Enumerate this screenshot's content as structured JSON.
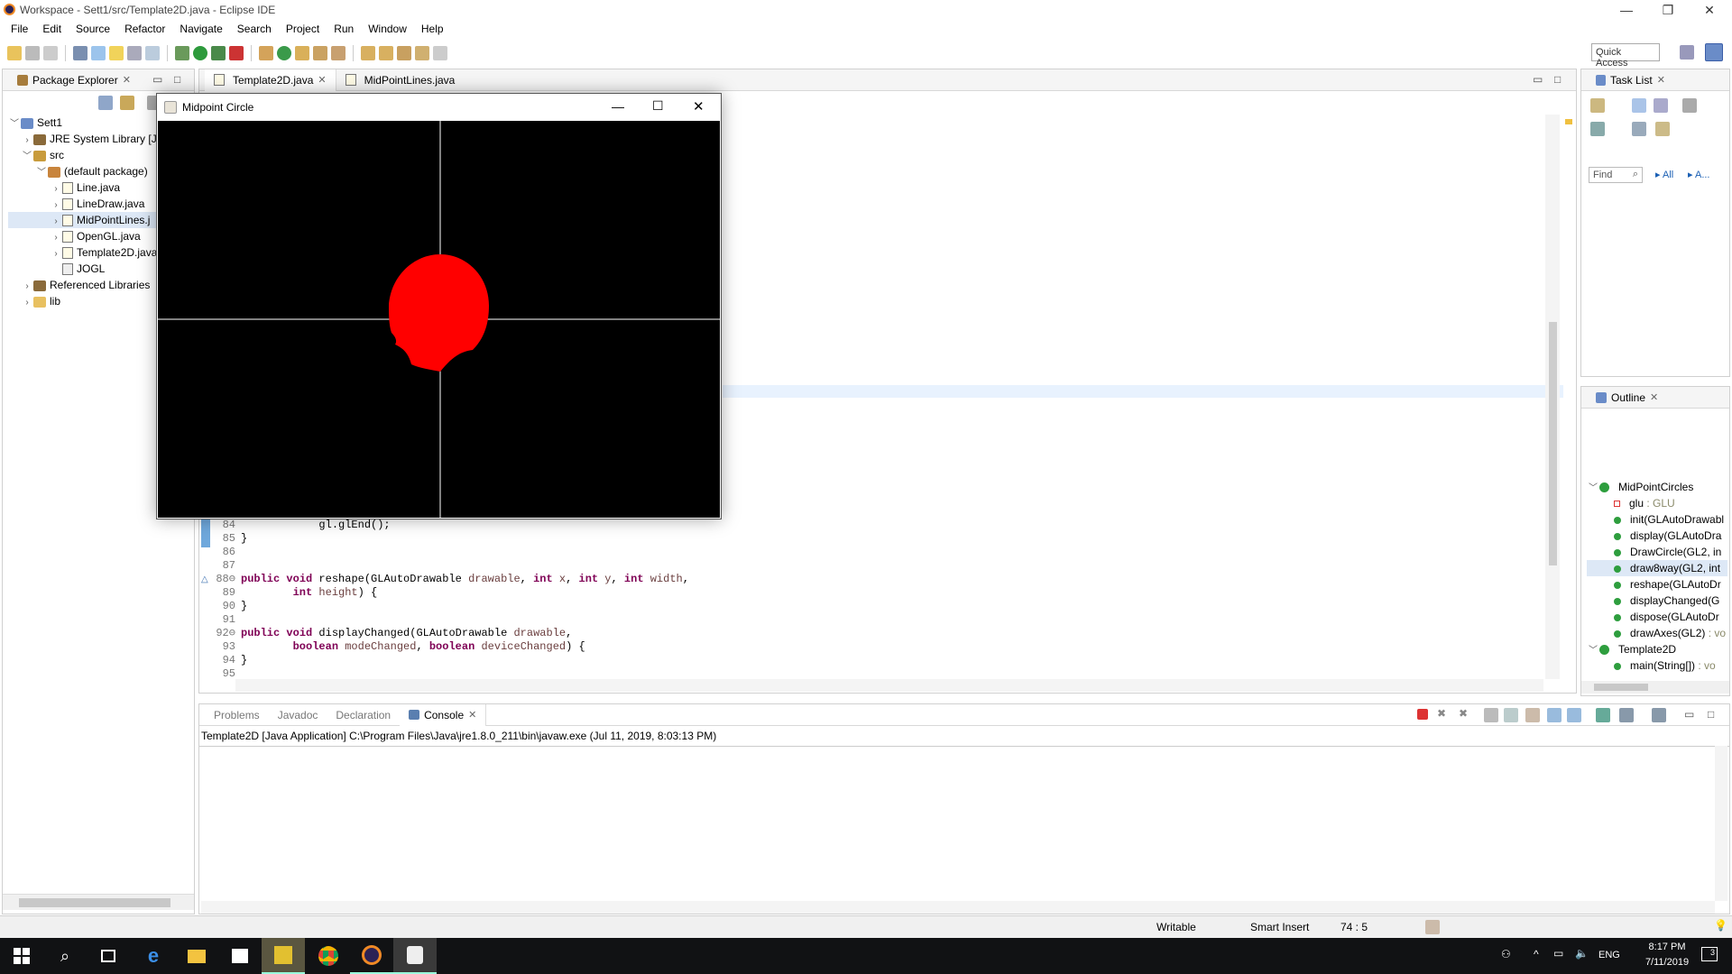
{
  "window": {
    "title": "Workspace - Sett1/src/Template2D.java - Eclipse IDE",
    "min": "—",
    "max": "❐",
    "close": "✕"
  },
  "menu": [
    "File",
    "Edit",
    "Source",
    "Refactor",
    "Navigate",
    "Search",
    "Project",
    "Run",
    "Window",
    "Help"
  ],
  "toolbar": {
    "quick_access": "Quick Access"
  },
  "package_explorer": {
    "title": "Package Explorer",
    "project": "Sett1",
    "jre": "JRE System Library [Ja",
    "src": "src",
    "default_package": "(default package)",
    "files": [
      "Line.java",
      "LineDraw.java",
      "MidPointLines.j",
      "OpenGL.java",
      "Template2D.java"
    ],
    "jogl": "JOGL",
    "referenced": "Referenced Libraries",
    "lib": "lib"
  },
  "editor": {
    "tabs": [
      "Template2D.java",
      "MidPointLines.java"
    ],
    "lines": [
      {
        "n": "84",
        "indent": "            ",
        "text": "gl.glEnd();"
      },
      {
        "n": "85",
        "indent": "",
        "text": "}"
      },
      {
        "n": "86",
        "indent": "",
        "text": ""
      },
      {
        "n": "87",
        "indent": "",
        "text": ""
      },
      {
        "n": "88⊖",
        "indent": "",
        "text": ""
      },
      {
        "n": "89",
        "indent": "",
        "text": ""
      },
      {
        "n": "90",
        "indent": "",
        "text": "}"
      },
      {
        "n": "91",
        "indent": "",
        "text": ""
      },
      {
        "n": "92⊖",
        "indent": "",
        "text": ""
      },
      {
        "n": "93",
        "indent": "",
        "text": ""
      },
      {
        "n": "94",
        "indent": "",
        "text": "}"
      },
      {
        "n": "95",
        "indent": "",
        "text": ""
      }
    ],
    "code88": {
      "kw1": "public",
      "kw2": "void",
      "name": " reshape(GLAutoDrawable ",
      "p1": "drawable",
      "s1": ", ",
      "kw3": "int",
      "p2": " x",
      "s2": ", ",
      "kw4": "int",
      "p3": " y",
      "s3": ", ",
      "kw5": "int",
      "p4": " width",
      "s4": ","
    },
    "code89": {
      "kw": "int",
      "p": " height",
      "s": ") {"
    },
    "code92": {
      "kw1": "public",
      "kw2": "void",
      "name": " displayChanged(GLAutoDrawable ",
      "p": "drawable",
      "s": ","
    },
    "code93": {
      "kw1": "boolean",
      "p1": " modeChanged",
      "s1": ", ",
      "kw2": "boolean",
      "p2": " deviceChanged",
      "s2": ") {"
    }
  },
  "midpoint_window": {
    "title": "Midpoint Circle"
  },
  "task_list": {
    "title": "Task List",
    "find": "Find",
    "all": "All",
    "a": "A..."
  },
  "outline": {
    "title": "Outline",
    "class1": "MidPointCircles",
    "members": [
      {
        "name": "glu",
        "type": " : GLU",
        "kind": "field"
      },
      {
        "name": "init(GLAutoDrawabl",
        "type": "",
        "kind": "method"
      },
      {
        "name": "display(GLAutoDra",
        "type": "",
        "kind": "method"
      },
      {
        "name": "DrawCircle(GL2, in",
        "type": "",
        "kind": "method"
      },
      {
        "name": "draw8way(GL2, int",
        "type": "",
        "kind": "method"
      },
      {
        "name": "reshape(GLAutoDr",
        "type": "",
        "kind": "method"
      },
      {
        "name": "displayChanged(G",
        "type": "",
        "kind": "method"
      },
      {
        "name": "dispose(GLAutoDr",
        "type": "",
        "kind": "method"
      },
      {
        "name": "drawAxes(GL2)",
        "type": " : vo",
        "kind": "method"
      }
    ],
    "class2": "Template2D",
    "main": "main(String[])",
    "main_type": " : vo"
  },
  "bottom": {
    "tabs": [
      "Problems",
      "Javadoc",
      "Declaration",
      "Console"
    ],
    "console_line": "Template2D [Java Application] C:\\Program Files\\Java\\jre1.8.0_211\\bin\\javaw.exe (Jul 11, 2019, 8:03:13 PM)"
  },
  "status": {
    "writable": "Writable",
    "insert": "Smart Insert",
    "pos": "74 : 5"
  },
  "taskbar": {
    "lang": "ENG",
    "time": "8:17 PM",
    "date": "7/11/2019",
    "notif": "3"
  },
  "colors": {
    "circle": "#ff0000",
    "canvas": "#000000",
    "axis": "#ffffff",
    "accent": "#3b7fd4"
  }
}
